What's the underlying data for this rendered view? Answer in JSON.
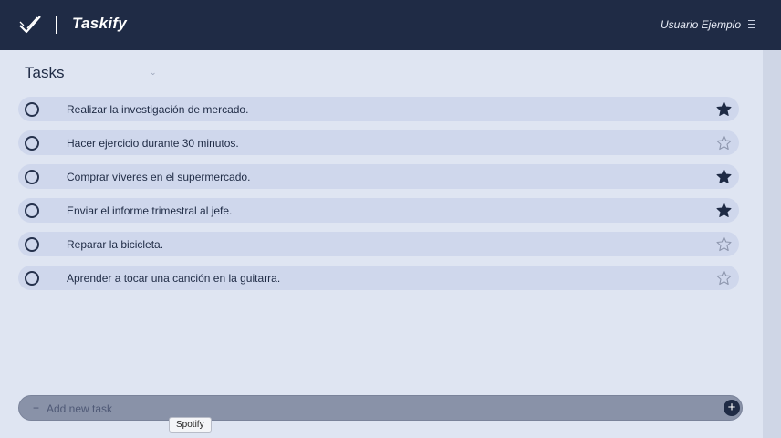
{
  "header": {
    "brand": "Taskify",
    "user_name": "Usuario Ejemplo",
    "logo_icon": "double-check-icon",
    "menu_icon": "menu-icon"
  },
  "main": {
    "title": "Tasks",
    "tasks": [
      {
        "text": "Realizar la investigación de mercado.",
        "starred": true
      },
      {
        "text": "Hacer ejercicio durante 30 minutos.",
        "starred": false
      },
      {
        "text": "Comprar víveres en el supermercado.",
        "starred": true
      },
      {
        "text": "Enviar el informe trimestral al jefe.",
        "starred": true
      },
      {
        "text": "Reparar la bicicleta.",
        "starred": false
      },
      {
        "text": "Aprender a tocar una canción en la guitarra.",
        "starred": false
      }
    ]
  },
  "add_task": {
    "placeholder": "Add new task",
    "plus_symbol": "+",
    "button_symbol": "+"
  },
  "tooltip": {
    "text": "Spotify"
  },
  "colors": {
    "header_bg": "#1f2b45",
    "task_bg": "#cfd7ec",
    "accent": "#1f2b45"
  }
}
